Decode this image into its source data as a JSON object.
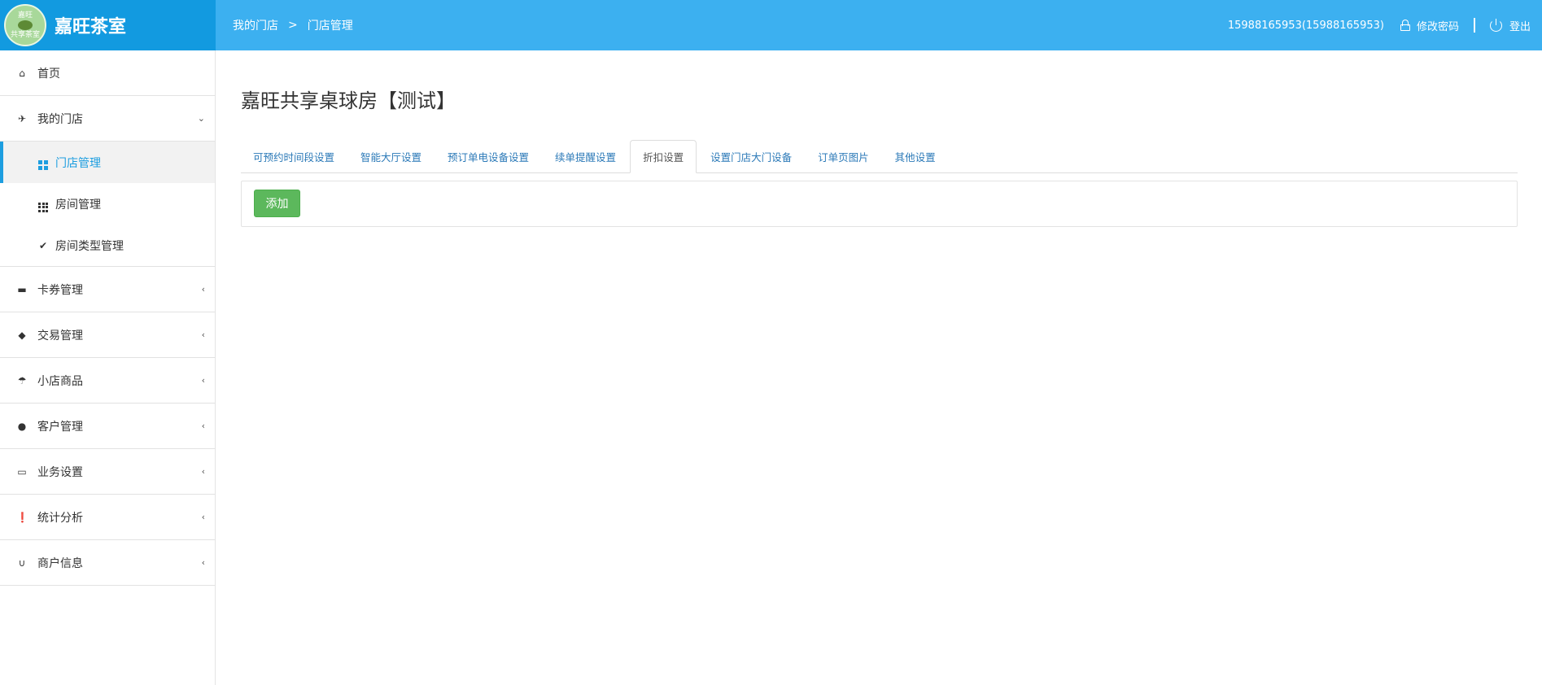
{
  "header": {
    "logo_text_top": "嘉旺",
    "logo_text_bottom": "共享茶室",
    "brand_name": "嘉旺茶室",
    "breadcrumb": [
      "我的门店",
      "门店管理"
    ],
    "breadcrumb_sep": ">",
    "user": "15988165953(15988165953)",
    "change_password": "修改密码",
    "logout": "登出",
    "bg_color": "#3cb0f0",
    "brand_bg_color": "#129ae0"
  },
  "sidebar": {
    "home": {
      "label": "首页",
      "icon": "home-icon"
    },
    "my_store": {
      "label": "我的门店",
      "icon": "plane-icon",
      "expanded": true,
      "children": [
        {
          "label": "门店管理",
          "icon": "dashboard-icon",
          "active": true
        },
        {
          "label": "房间管理",
          "icon": "grid-icon"
        },
        {
          "label": "房间类型管理",
          "icon": "check-icon"
        }
      ]
    },
    "items": [
      {
        "label": "卡券管理",
        "icon": "folder-icon"
      },
      {
        "label": "交易管理",
        "icon": "tags-icon"
      },
      {
        "label": "小店商品",
        "icon": "umbrella-icon"
      },
      {
        "label": "客户管理",
        "icon": "user-icon"
      },
      {
        "label": "业务设置",
        "icon": "inbox-icon"
      },
      {
        "label": "统计分析",
        "icon": "exclamation-icon"
      },
      {
        "label": "商户信息",
        "icon": "magnet-icon"
      }
    ],
    "accent_color": "#1d9ee0"
  },
  "main": {
    "title": "嘉旺共享桌球房【测试】",
    "tabs": [
      {
        "label": "可预约时间段设置",
        "active": false
      },
      {
        "label": "智能大厅设置",
        "active": false
      },
      {
        "label": "预订单电设备设置",
        "active": false
      },
      {
        "label": "续单提醒设置",
        "active": false
      },
      {
        "label": "折扣设置",
        "active": true
      },
      {
        "label": "设置门店大门设备",
        "active": false
      },
      {
        "label": "订单页图片",
        "active": false
      },
      {
        "label": "其他设置",
        "active": false
      }
    ],
    "add_button": "添加",
    "add_button_color": "#5cb85c"
  }
}
